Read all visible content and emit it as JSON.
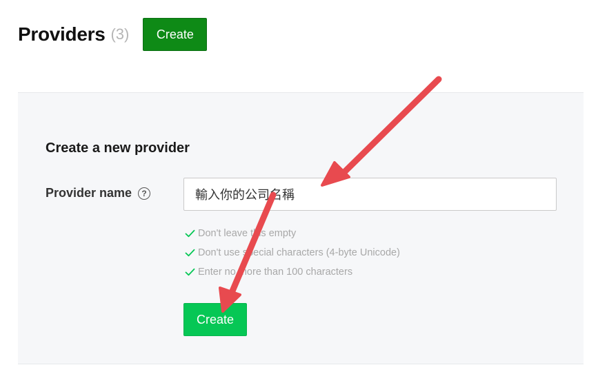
{
  "header": {
    "title": "Providers",
    "count": "(3)",
    "create_label": "Create"
  },
  "form": {
    "title": "Create a new provider",
    "provider_name_label": "Provider name",
    "help_glyph": "?",
    "provider_name_value": "輸入你的公司名稱",
    "rules": [
      "Don't leave this empty",
      "Don't use special characters (4-byte Unicode)",
      "Enter no more than 100 characters"
    ],
    "create_label": "Create"
  },
  "colors": {
    "header_button": "#0e8a16",
    "primary_button": "#06c755",
    "check": "#06c755",
    "panel_background": "#f6f7f9",
    "annotation_arrow": "#e84a4f"
  },
  "icons": {
    "help": "question-circle-icon",
    "rule_check": "check-icon"
  }
}
